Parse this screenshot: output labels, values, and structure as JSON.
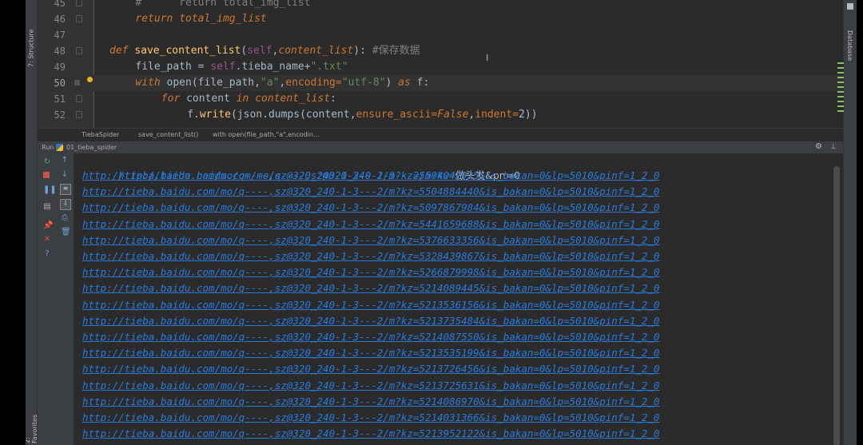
{
  "left_tabs": {
    "structure": "7: Structure",
    "favorites": "2: Favorites"
  },
  "right_tabs": {
    "database": "Database"
  },
  "editor": {
    "lines": [
      {
        "n": "45",
        "tokens": [
          [
            "cmt",
            "#      return total_img_list"
          ]
        ]
      },
      {
        "n": "46",
        "tokens": [
          [
            "kwi",
            "return "
          ],
          [
            "ital",
            "total_img_list"
          ]
        ]
      },
      {
        "n": "47",
        "tokens": []
      },
      {
        "n": "48",
        "tokens": [
          [
            "kwi",
            "def "
          ],
          [
            "fn",
            "save_content_list"
          ],
          [
            "param",
            "("
          ],
          [
            "self",
            "self"
          ],
          [
            "param",
            ","
          ],
          [
            "ital",
            "content_list"
          ],
          [
            "param",
            "): "
          ],
          [
            "cmt",
            "#保存数据"
          ]
        ]
      },
      {
        "n": "49",
        "tokens": [
          [
            "param",
            "file_path = "
          ],
          [
            "self",
            "self"
          ],
          [
            "param",
            ".tieba_name+"
          ],
          [
            "str",
            "\".txt\""
          ]
        ]
      },
      {
        "n": "50",
        "tokens": [
          [
            "kwi",
            "with "
          ],
          [
            "param",
            "open(file_path,"
          ],
          [
            "str",
            "\"a\""
          ],
          [
            "param",
            ","
          ],
          [
            "kw",
            "encoding="
          ],
          [
            "str",
            "\"utf-8\""
          ],
          [
            "param",
            ") "
          ],
          [
            "kwi",
            "as "
          ],
          [
            "param",
            "f:"
          ]
        ]
      },
      {
        "n": "51",
        "tokens": [
          [
            "kwi",
            "for "
          ],
          [
            "param",
            "content "
          ],
          [
            "kwi",
            "in "
          ],
          [
            "ital",
            "content_list"
          ],
          [
            "param",
            ":"
          ]
        ]
      },
      {
        "n": "52",
        "tokens": [
          [
            "param",
            "f."
          ],
          [
            "fn",
            "write"
          ],
          [
            "param",
            "(json.dumps(content,"
          ],
          [
            "kw",
            "ensure_ascii="
          ],
          [
            "kwi",
            "False"
          ],
          [
            "param",
            ","
          ],
          [
            "kw",
            "indent="
          ],
          [
            "param",
            "2))"
          ]
        ]
      }
    ]
  },
  "breadcrumb": [
    "TiebaSpider",
    "save_content_list()",
    "with open(file_path,\"a\",encodin..."
  ],
  "run": {
    "label": "Run",
    "config": "01_tieba_spider"
  },
  "console": {
    "first": {
      "url": "http://tieba.baidu.com/mo/q----,sz@320_240-1-3---2/m?kw=",
      "tail": "做头发&pn=0"
    },
    "urls": [
      "http://tieba.baidu.com/mo/q----,sz@320_240-1-3---2/m?kz=5504042925&is_bakan=0&lp=5010&pinf=1_2_0",
      "http://tieba.baidu.com/mo/q----,sz@320_240-1-3---2/m?kz=5504884440&is_bakan=0&lp=5010&pinf=1_2_0",
      "http://tieba.baidu.com/mo/q----,sz@320_240-1-3---2/m?kz=5097867984&is_bakan=0&lp=5010&pinf=1_2_0",
      "http://tieba.baidu.com/mo/q----,sz@320_240-1-3---2/m?kz=5441659688&is_bakan=0&lp=5010&pinf=1_2_0",
      "http://tieba.baidu.com/mo/q----,sz@320_240-1-3---2/m?kz=5376633356&is_bakan=0&lp=5010&pinf=1_2_0",
      "http://tieba.baidu.com/mo/q----,sz@320_240-1-3---2/m?kz=5328439867&is_bakan=0&lp=5010&pinf=1_2_0",
      "http://tieba.baidu.com/mo/q----,sz@320_240-1-3---2/m?kz=5266879998&is_bakan=0&lp=5010&pinf=1_2_0",
      "http://tieba.baidu.com/mo/q----,sz@320_240-1-3---2/m?kz=5214089445&is_bakan=0&lp=5010&pinf=1_2_0",
      "http://tieba.baidu.com/mo/q----,sz@320_240-1-3---2/m?kz=5213536156&is_bakan=0&lp=5010&pinf=1_2_0",
      "http://tieba.baidu.com/mo/q----,sz@320_240-1-3---2/m?kz=5213735484&is_bakan=0&lp=5010&pinf=1_2_0",
      "http://tieba.baidu.com/mo/q----,sz@320_240-1-3---2/m?kz=5214087550&is_bakan=0&lp=5010&pinf=1_2_0",
      "http://tieba.baidu.com/mo/q----,sz@320_240-1-3---2/m?kz=5213535199&is_bakan=0&lp=5010&pinf=1_2_0",
      "http://tieba.baidu.com/mo/q----,sz@320_240-1-3---2/m?kz=5213726456&is_bakan=0&lp=5010&pinf=1_2_0",
      "http://tieba.baidu.com/mo/q----,sz@320_240-1-3---2/m?kz=5213725631&is_bakan=0&lp=5010&pinf=1_2_0",
      "http://tieba.baidu.com/mo/q----,sz@320_240-1-3---2/m?kz=5214086970&is_bakan=0&lp=5010&pinf=1_2_0",
      "http://tieba.baidu.com/mo/q----,sz@320_240-1-3---2/m?kz=5214031366&is_bakan=0&lp=5010&pinf=1_2_0",
      "http://tieba.baidu.com/mo/q----,sz@320_240-1-3---2/m?kz=5213952122&is_bakan=0&lp=5010&pinf=1_2_0"
    ]
  },
  "colors": {
    "link": "#287bde",
    "background": "#2b2b2b",
    "keyword": "#cc7832",
    "string": "#6a8759",
    "function": "#ffc66d"
  },
  "icons": [
    "rerun-icon",
    "stop-icon",
    "pause-icon",
    "scroll-up-icon",
    "scroll-down-icon",
    "soft-wrap-icon",
    "scroll-to-end-icon",
    "print-icon",
    "trash-icon",
    "pin-icon",
    "close-icon",
    "help-icon",
    "gear-icon",
    "minimize-icon",
    "bulb-icon",
    "fold-icon"
  ]
}
